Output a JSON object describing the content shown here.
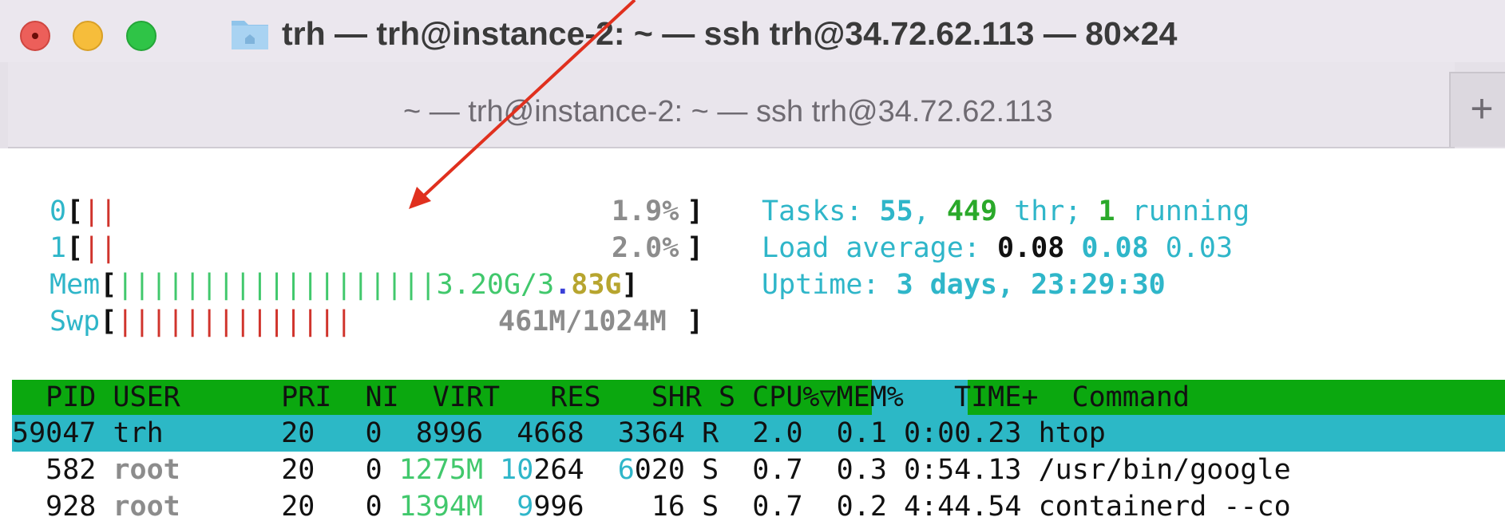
{
  "window": {
    "title": "trh — trh@instance-2: ~ — ssh trh@34.72.62.113 — 80×24",
    "tab_title": "~ — trh@instance-2: ~ — ssh trh@34.72.62.113",
    "new_tab_label": "+"
  },
  "meters": {
    "cpu0": {
      "label": "0",
      "percent": "1.9%",
      "bar": "||"
    },
    "cpu1": {
      "label": "1",
      "percent": "2.0%",
      "bar": "||"
    },
    "mem": {
      "label": "Mem",
      "bar": "|||||||||||||||||||",
      "used": "3.20G",
      "sep": "/3",
      "dot": ".",
      "total": "83G"
    },
    "swp": {
      "label": "Swp",
      "bar": "||||||||||||||",
      "value": "461M/1024M"
    }
  },
  "summary": {
    "tasks_label": "Tasks: ",
    "tasks": "55",
    "comma": ", ",
    "threads": "449",
    "thr_label": " thr; ",
    "running": "1",
    "running_label": " running",
    "load_label": "Load average: ",
    "load1": "0.08",
    "load5": "0.08",
    "load15": "0.03",
    "uptime_label": "Uptime: ",
    "uptime": "3 days, 23:29:30"
  },
  "table": {
    "header": "  PID USER      PRI  NI  VIRT   RES   SHR S ",
    "header_sort": "CPU%▽",
    "header_rest": "MEM%   TIME+  Command",
    "rows": [
      {
        "pid": "59047",
        "user": "trh",
        "pri": "20",
        "ni": "0",
        "virt": "8996",
        "res": "4668",
        "shr": "3364",
        "s": "R",
        "cpu": "2.0",
        "mem": "0.1",
        "time": "0:00.23",
        "cmd": "htop"
      },
      {
        "pid": "582",
        "user": "root",
        "pri": "20",
        "ni": "0",
        "virt_a": "1275M",
        "res_a": "10",
        "res_b": "264",
        "shr_a": "6",
        "shr_b": "020",
        "s": "S",
        "cpu": "0.7",
        "mem": "0.3",
        "time": "0:54.13",
        "cmd": "/usr/bin/google"
      },
      {
        "pid": "928",
        "user": "root",
        "pri": "20",
        "ni": "0",
        "virt_a": "1394M",
        "res_a": "9",
        "res_b": "996",
        "shr": "16",
        "s": "S",
        "cpu": "0.7",
        "mem": "0.2",
        "time": "4:44.54",
        "cmd": "containerd --co"
      }
    ]
  },
  "annotation": {
    "color": "#e0301e"
  }
}
